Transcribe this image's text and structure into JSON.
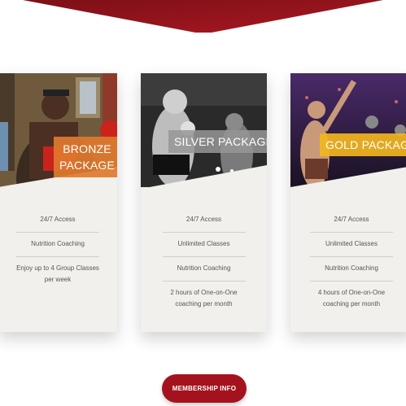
{
  "packages": [
    {
      "label_lines": [
        "BRONZE",
        "PACKAGE"
      ],
      "label_color": "#e07a2e",
      "features": [
        "24/7 Access",
        "Nutrition Coaching",
        "Enjoy up to 4 Group Classes per week"
      ]
    },
    {
      "label_lines": [
        "SILVER PACKAGE"
      ],
      "label_color": "#8c8c8c",
      "features": [
        "24/7 Access",
        "Unlimited Classes",
        "Nutrition Coaching",
        "2 hours of One-on-One coaching per month"
      ]
    },
    {
      "label_lines": [
        "GOLD PACKAGE"
      ],
      "label_color": "#f2b51e",
      "features": [
        "24/7 Access",
        "Unlimited Classes",
        "Nutrition Coaching",
        "4 hours of One-on-One coaching per month"
      ]
    }
  ],
  "cta": {
    "label": "MEMBERSHIP INFO"
  },
  "colors": {
    "brand": "#a4131d",
    "card_bg": "#f1f0ec"
  }
}
